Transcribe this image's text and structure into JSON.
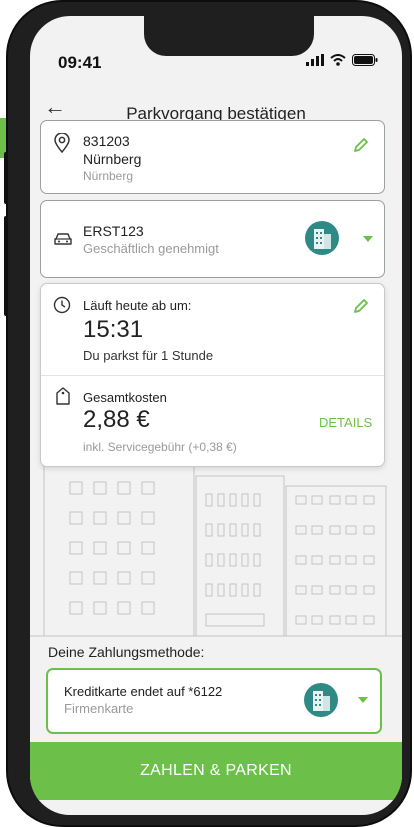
{
  "status_bar": {
    "time": "09:41"
  },
  "header": {
    "title": "Parkvorgang bestätigen"
  },
  "location": {
    "zone": "831203",
    "city": "Nürnberg",
    "city_sub": "Nürnberg"
  },
  "vehicle": {
    "plate": "ERST123",
    "status": "Geschäftlich genehmigt"
  },
  "duration": {
    "label": "Läuft heute ab um:",
    "time": "15:31",
    "note": "Du parkst für 1 Stunde"
  },
  "costs": {
    "label": "Gesamtkosten",
    "amount": "2,88 €",
    "fee": "inkl. Servicegebühr (+0,38 €)",
    "details_link": "DETAILS"
  },
  "payment": {
    "section_label": "Deine Zahlungsmethode:",
    "card_title": "Kreditkarte endet auf *6122",
    "card_type": "Firmenkarte"
  },
  "cta": {
    "label": "ZAHLEN & PARKEN"
  },
  "colors": {
    "accent": "#6cc04a",
    "company_icon": "#2f8a86"
  },
  "icons": [
    "back-arrow-icon",
    "location-pin-icon",
    "pencil-icon",
    "car-icon",
    "company-building-icon",
    "chevron-down-icon",
    "clock-icon",
    "price-tag-icon"
  ]
}
